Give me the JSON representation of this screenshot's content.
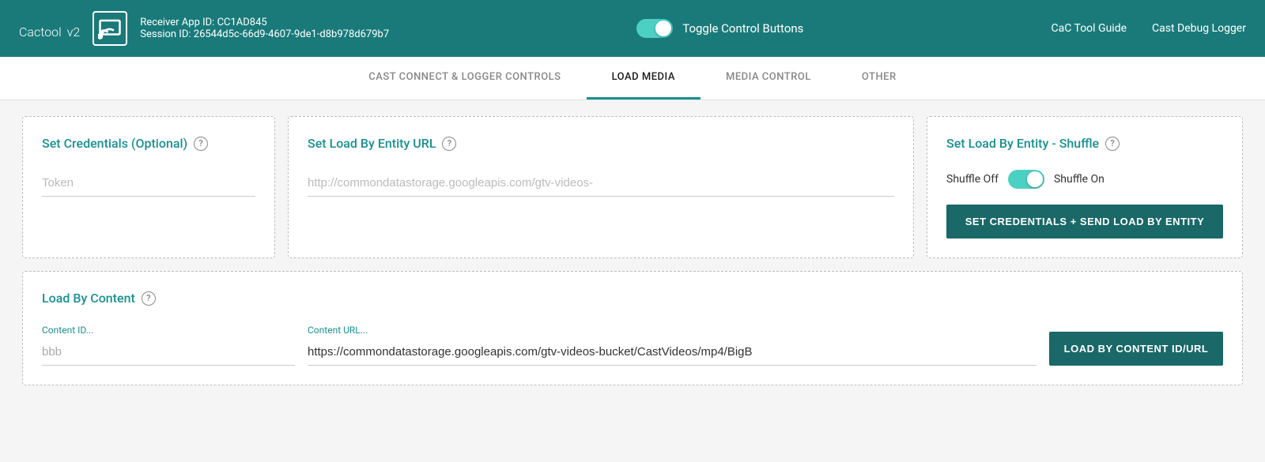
{
  "header": {
    "logo": "Cactool",
    "version": "v2",
    "receiver_app_label": "Receiver App ID:",
    "receiver_app_id": "CC1AD845",
    "session_label": "Session ID:",
    "session_id": "26544d5c-66d9-4607-9de1-d8b978d679b7",
    "toggle_label": "Toggle Control Buttons",
    "nav_guide": "CaC Tool Guide",
    "nav_logger": "Cast Debug Logger"
  },
  "tabs": [
    {
      "id": "cast-connect",
      "label": "CAST CONNECT & LOGGER CONTROLS",
      "active": false
    },
    {
      "id": "load-media",
      "label": "LOAD MEDIA",
      "active": true
    },
    {
      "id": "media-control",
      "label": "MEDIA CONTROL",
      "active": false
    },
    {
      "id": "other",
      "label": "OTHER",
      "active": false
    }
  ],
  "cards": {
    "credentials": {
      "title": "Set Credentials (Optional)",
      "token_placeholder": "Token"
    },
    "entity_url": {
      "title": "Set Load By Entity URL",
      "url_placeholder": "http://commondatastorage.googleapis.com/gtv-videos-"
    },
    "shuffle": {
      "title": "Set Load By Entity - Shuffle",
      "shuffle_off_label": "Shuffle Off",
      "shuffle_on_label": "Shuffle On",
      "button_label": "SET CREDENTIALS + SEND LOAD BY ENTITY"
    },
    "load_content": {
      "title": "Load By Content",
      "content_id_label": "Content ID...",
      "content_id_value": "bbb",
      "content_url_label": "Content URL...",
      "content_url_value": "https://commondatastorage.googleapis.com/gtv-videos-bucket/CastVideos/mp4/BigB",
      "button_label": "LOAD BY CONTENT ID/URL"
    }
  },
  "icons": {
    "help": "?"
  }
}
